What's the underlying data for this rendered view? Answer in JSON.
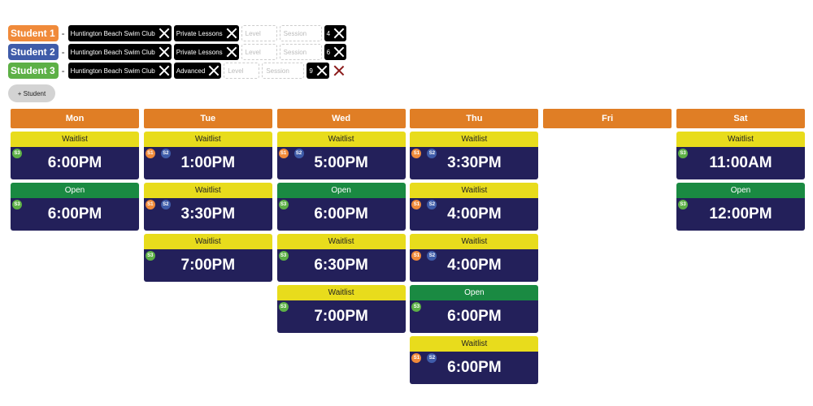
{
  "colors": {
    "s1": "#f08a3a",
    "s2": "#3f5ca9",
    "s3": "#5db046",
    "day_header": "#e07e25",
    "waitlist": "#e8dc1c",
    "open": "#1a8a42",
    "time_bg": "#23205a"
  },
  "students": [
    {
      "label": "Student 1",
      "club": "Huntington Beach Swim Club",
      "program": "Private Lessons",
      "level": "Level",
      "session": "Session",
      "count": "4",
      "deletable": false
    },
    {
      "label": "Student 2",
      "club": "Huntington Beach Swim Club",
      "program": "Private Lessons",
      "level": "Level",
      "session": "Session",
      "count": "6",
      "deletable": false
    },
    {
      "label": "Student 3",
      "club": "Huntington Beach Swim Club",
      "program": "Advanced",
      "level": "Level",
      "session": "Session",
      "count": "9",
      "deletable": true
    }
  ],
  "add_student_label": "+ Student",
  "days": [
    {
      "name": "Mon",
      "slots": [
        {
          "status": "Waitlist",
          "time": "6:00PM",
          "badges": [
            "S3"
          ]
        },
        {
          "status": "Open",
          "time": "6:00PM",
          "badges": [
            "S3"
          ]
        }
      ]
    },
    {
      "name": "Tue",
      "slots": [
        {
          "status": "Waitlist",
          "time": "1:00PM",
          "badges": [
            "S1",
            "S2"
          ]
        },
        {
          "status": "Waitlist",
          "time": "3:30PM",
          "badges": [
            "S1",
            "S2"
          ]
        },
        {
          "status": "Waitlist",
          "time": "7:00PM",
          "badges": [
            "S3"
          ]
        }
      ]
    },
    {
      "name": "Wed",
      "slots": [
        {
          "status": "Waitlist",
          "time": "5:00PM",
          "badges": [
            "S1",
            "S2"
          ]
        },
        {
          "status": "Open",
          "time": "6:00PM",
          "badges": [
            "S3"
          ]
        },
        {
          "status": "Waitlist",
          "time": "6:30PM",
          "badges": [
            "S3"
          ]
        },
        {
          "status": "Waitlist",
          "time": "7:00PM",
          "badges": [
            "S3"
          ]
        }
      ]
    },
    {
      "name": "Thu",
      "slots": [
        {
          "status": "Waitlist",
          "time": "3:30PM",
          "badges": [
            "S1",
            "S2"
          ]
        },
        {
          "status": "Waitlist",
          "time": "4:00PM",
          "badges": [
            "S1",
            "S2"
          ]
        },
        {
          "status": "Waitlist",
          "time": "4:00PM",
          "badges": [
            "S1",
            "S2"
          ]
        },
        {
          "status": "Open",
          "time": "6:00PM",
          "badges": [
            "S3"
          ]
        },
        {
          "status": "Waitlist",
          "time": "6:00PM",
          "badges": [
            "S1",
            "S2"
          ]
        }
      ]
    },
    {
      "name": "Fri",
      "slots": []
    },
    {
      "name": "Sat",
      "slots": [
        {
          "status": "Waitlist",
          "time": "11:00AM",
          "badges": [
            "S3"
          ]
        },
        {
          "status": "Open",
          "time": "12:00PM",
          "badges": [
            "S3"
          ]
        }
      ]
    }
  ]
}
